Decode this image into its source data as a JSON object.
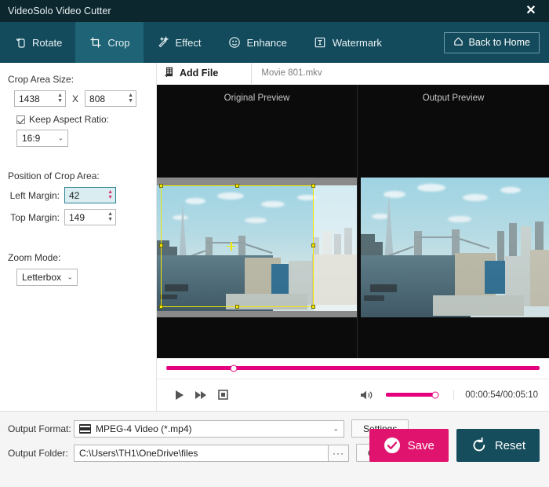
{
  "window": {
    "title": "VideoSolo Video Cutter",
    "close_label": "✕"
  },
  "tabs": [
    {
      "label": "Rotate",
      "icon": "rotate-icon",
      "active": false
    },
    {
      "label": "Crop",
      "icon": "crop-icon",
      "active": true
    },
    {
      "label": "Effect",
      "icon": "effect-icon",
      "active": false
    },
    {
      "label": "Enhance",
      "icon": "enhance-icon",
      "active": false
    },
    {
      "label": "Watermark",
      "icon": "watermark-icon",
      "active": false
    }
  ],
  "back_home": {
    "label": "Back to Home",
    "icon": "home-icon"
  },
  "crop_panel": {
    "size_label": "Crop Area Size:",
    "width_value": "1438",
    "x_separator": "X",
    "height_value": "808",
    "keep_aspect_label": "Keep Aspect Ratio:",
    "keep_aspect_checked": true,
    "aspect_value": "16:9",
    "position_label": "Position of Crop Area:",
    "left_margin_label": "Left Margin:",
    "left_margin_value": "42",
    "top_margin_label": "Top Margin:",
    "top_margin_value": "149",
    "zoom_mode_label": "Zoom Mode:",
    "zoom_mode_value": "Letterbox"
  },
  "preview": {
    "add_file_label": "Add File",
    "file_name": "Movie 801.mkv",
    "original_title": "Original Preview",
    "output_title": "Output Preview"
  },
  "player": {
    "play_label": "Play",
    "forward_label": "Fast Forward",
    "stop_label": "Stop",
    "volume_label": "Volume",
    "timecode": "00:00:54/00:05:10",
    "seek_percent": 18,
    "volume_percent": 100
  },
  "output": {
    "format_label": "Output Format:",
    "format_value": "MPEG-4 Video (*.mp4)",
    "settings_label": "Settings",
    "folder_label": "Output Folder:",
    "folder_value": "C:\\Users\\TH1\\OneDrive\\files",
    "browse_label": "···",
    "open_folder_label": "Open Folder"
  },
  "actions": {
    "save_label": "Save",
    "reset_label": "Reset"
  },
  "colors": {
    "titlebar": "#0c272e",
    "tabbar": "#144b5c",
    "tab_active": "#1e6476",
    "accent_pink": "#e4007f",
    "save_pink": "#e0146e",
    "reset_teal": "#164d5c",
    "crop_outline": "#f2e800"
  }
}
